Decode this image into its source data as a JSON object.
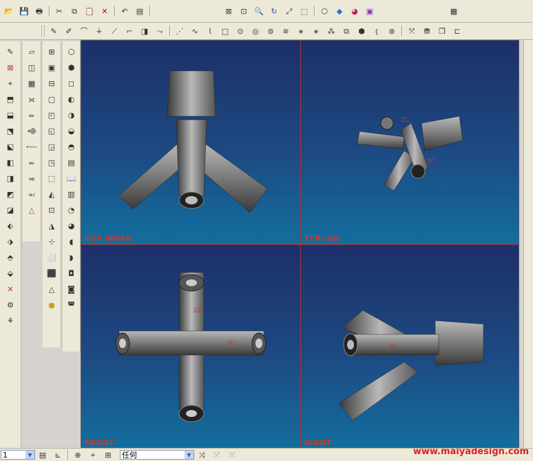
{
  "toolbar_top": {
    "icons": [
      "open-icon",
      "save-icon",
      "print-icon",
      "cut-icon",
      "copy-icon",
      "paste-icon",
      "delete-icon",
      "undo-icon",
      "information-icon",
      "fit-icon",
      "zoom-window-icon",
      "zoom-icon",
      "rotate-icon",
      "pan-icon",
      "view-icon",
      "render-icon",
      "shade-icon",
      "color-icon",
      "layer-icon",
      "help-icon"
    ]
  },
  "toolbar_second": {
    "icons": [
      "point-icon",
      "line-icon",
      "arc-icon",
      "spline-icon",
      "rectangle-icon",
      "circle-icon",
      "ellipse-icon",
      "curve-icon",
      "edit-curve-icon",
      "trim-icon",
      "fillet-icon",
      "chamfer-icon",
      "offset-icon",
      "mirror-icon",
      "transform-icon",
      "measure-icon",
      "analysis-icon"
    ]
  },
  "viewports": {
    "top_left_label": "TOP WORK",
    "top_right_label": "TFR-ISO",
    "bottom_left_label": "FRONT",
    "bottom_right_label": "RIGHT",
    "axis_labels": {
      "zc": "ZC",
      "xc": "XC"
    }
  },
  "status_bar": {
    "layer_value": "1",
    "filter_value": "任何"
  },
  "watermark": "www.maiyadesign.com",
  "colors": {
    "label_red": "#c23a2c",
    "viewport_bg_top": "#1d2f6a",
    "viewport_bg_bottom": "#136e9e",
    "divider": "#b03030"
  }
}
